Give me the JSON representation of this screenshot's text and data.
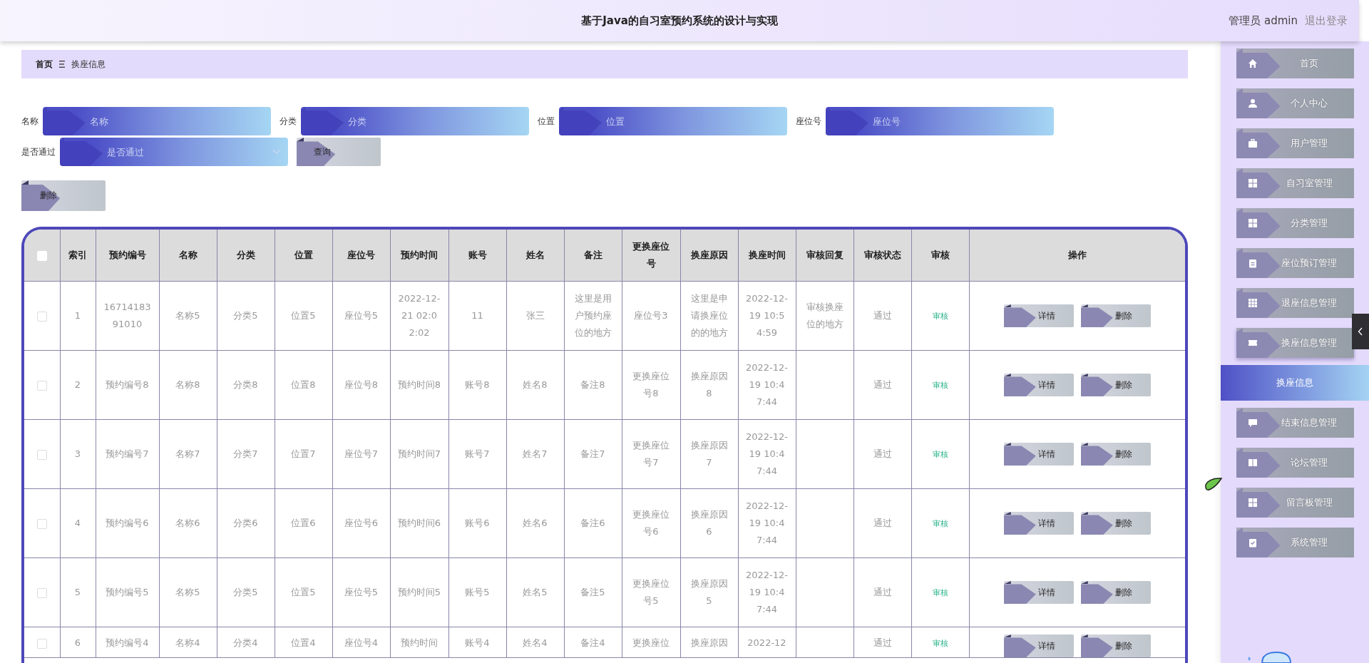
{
  "header": {
    "title": "基于Java的自习室预约系统的设计与实现",
    "user": "管理员 admin",
    "logout": "退出登录"
  },
  "breadcrumb": {
    "home": "首页",
    "current": "换座信息"
  },
  "search": {
    "rows": [
      [
        {
          "label": "名称",
          "placeholder": "名称",
          "kind": "input"
        },
        {
          "label": "分类",
          "placeholder": "分类",
          "kind": "input"
        },
        {
          "label": "位置",
          "placeholder": "位置",
          "kind": "input"
        },
        {
          "label": "座位号",
          "placeholder": "座位号",
          "kind": "input"
        }
      ],
      [
        {
          "label": "是否通过",
          "placeholder": "是否通过",
          "kind": "select"
        }
      ]
    ],
    "button": "查询"
  },
  "delete_button": "删除",
  "table": {
    "header_checked": false,
    "columns": [
      "索引",
      "预约编号",
      "名称",
      "分类",
      "位置",
      "座位号",
      "预约时间",
      "账号",
      "姓名",
      "备注",
      "更换座位号",
      "换座原因",
      "换座时间",
      "审核回复",
      "审核状态",
      "审核",
      "操作"
    ],
    "rows": [
      {
        "checked": false,
        "index": "1",
        "booking_no": "1671418391010",
        "name": "名称5",
        "category": "分类5",
        "location": "位置5",
        "seat": "座位号5",
        "time": "2022-12-21 02:02:02",
        "account": "11",
        "user": "张三",
        "remark": "这里是用户预约座位的地方",
        "new_seat": "座位号3",
        "reason": "这里是申请换座位的的地方",
        "swap_time": "2022-12-19 10:54:59",
        "reply": "审核换座位的地方",
        "status": "通过",
        "audit": "审核",
        "actions": [
          "详情",
          "删除"
        ]
      },
      {
        "checked": false,
        "index": "2",
        "booking_no": "预约编号8",
        "name": "名称8",
        "category": "分类8",
        "location": "位置8",
        "seat": "座位号8",
        "time": "预约时间8",
        "account": "账号8",
        "user": "姓名8",
        "remark": "备注8",
        "new_seat": "更换座位号8",
        "reason": "换座原因8",
        "swap_time": "2022-12-19 10:47:44",
        "status": "通过",
        "audit": "审核",
        "actions": [
          "详情",
          "删除"
        ]
      },
      {
        "checked": false,
        "index": "3",
        "booking_no": "预约编号7",
        "name": "名称7",
        "category": "分类7",
        "location": "位置7",
        "seat": "座位号7",
        "time": "预约时间7",
        "account": "账号7",
        "user": "姓名7",
        "remark": "备注7",
        "new_seat": "更换座位号7",
        "reason": "换座原因7",
        "swap_time": "2022-12-19 10:47:44",
        "status": "通过",
        "audit": "审核",
        "actions": [
          "详情",
          "删除"
        ]
      },
      {
        "checked": false,
        "index": "4",
        "booking_no": "预约编号6",
        "name": "名称6",
        "category": "分类6",
        "location": "位置6",
        "seat": "座位号6",
        "time": "预约时间6",
        "account": "账号6",
        "user": "姓名6",
        "remark": "备注6",
        "new_seat": "更换座位号6",
        "reason": "换座原因6",
        "swap_time": "2022-12-19 10:47:44",
        "status": "通过",
        "audit": "审核",
        "actions": [
          "详情",
          "删除"
        ]
      },
      {
        "checked": false,
        "index": "5",
        "booking_no": "预约编号5",
        "name": "名称5",
        "category": "分类5",
        "location": "位置5",
        "seat": "座位号5",
        "time": "预约时间5",
        "account": "账号5",
        "user": "姓名5",
        "remark": "备注5",
        "new_seat": "更换座位号5",
        "reason": "换座原因5",
        "swap_time": "2022-12-19 10:47:44",
        "status": "通过",
        "audit": "审核",
        "actions": [
          "详情",
          "删除"
        ]
      },
      {
        "checked": false,
        "index": "6",
        "booking_no": "预约编号4",
        "name": "名称4",
        "category": "分类4",
        "location": "位置4",
        "seat": "座位号4",
        "time": "预约时间",
        "account": "账号4",
        "user": "姓名4",
        "remark": "备注4",
        "new_seat": "更换座位",
        "reason": "换座原因",
        "swap_time": "2022-12",
        "status": "通过",
        "audit": "审核",
        "actions": [
          "详情",
          "删除"
        ]
      }
    ]
  },
  "sidebar": {
    "items": [
      {
        "label": "首页",
        "selected": false
      },
      {
        "label": "个人中心",
        "selected": false
      },
      {
        "label": "用户管理",
        "selected": false
      },
      {
        "label": "自习室管理",
        "selected": false
      },
      {
        "label": "分类管理",
        "selected": false
      },
      {
        "label": "座位预订管理",
        "selected": false
      },
      {
        "label": "退座信息管理",
        "selected": false
      },
      {
        "label": "换座信息管理",
        "selected": false,
        "expanded": true,
        "children": [
          {
            "label": "换座信息",
            "selected": true
          }
        ]
      },
      {
        "label": "结束信息管理",
        "selected": false
      },
      {
        "label": "论坛管理",
        "selected": false
      },
      {
        "label": "留言板管理",
        "selected": false
      },
      {
        "label": "系统管理",
        "selected": false
      }
    ]
  }
}
